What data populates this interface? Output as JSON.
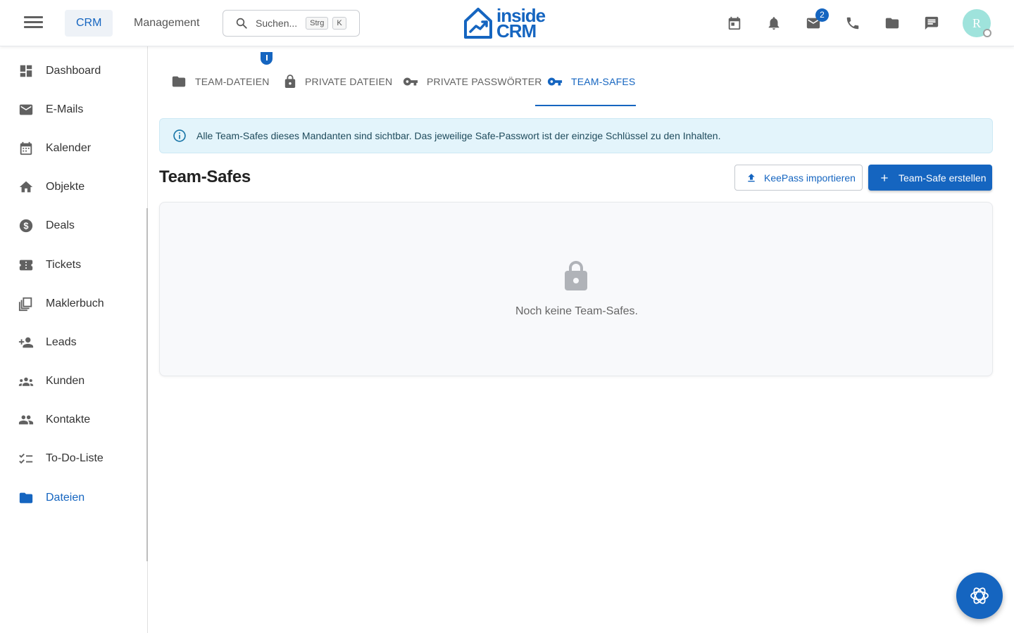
{
  "header": {
    "nav": [
      "CRM",
      "Management"
    ],
    "search": {
      "placeholder": "Suchen...",
      "shortcut": [
        "Strg",
        "K"
      ]
    },
    "logo": {
      "line1": "inside",
      "line2": "CRM"
    },
    "icons": [
      "calendar-icon",
      "bell-icon",
      "mail-icon",
      "phone-icon",
      "folder-icon",
      "chat-icon"
    ],
    "mail_badge": "2",
    "avatar_initial": "R"
  },
  "sidebar": {
    "items": [
      {
        "label": "Dashboard",
        "icon": "dashboard-icon"
      },
      {
        "label": "E-Mails",
        "icon": "mail-icon"
      },
      {
        "label": "Kalender",
        "icon": "calendar-icon"
      },
      {
        "label": "Objekte",
        "icon": "home-icon"
      },
      {
        "label": "Deals",
        "icon": "dollar-icon"
      },
      {
        "label": "Tickets",
        "icon": "ticket-icon"
      },
      {
        "label": "Maklerbuch",
        "icon": "book-icon"
      },
      {
        "label": "Leads",
        "icon": "person-add-icon"
      },
      {
        "label": "Kunden",
        "icon": "groups-icon"
      },
      {
        "label": "Kontakte",
        "icon": "people-icon"
      },
      {
        "label": "To-Do-Liste",
        "icon": "checklist-icon"
      },
      {
        "label": "Dateien",
        "icon": "folder-icon",
        "active": true
      }
    ]
  },
  "tabs": [
    {
      "label": "TEAM-DATEIEN",
      "icon": "folder-icon"
    },
    {
      "label": "PRIVATE DATEIEN",
      "icon": "lock-icon"
    },
    {
      "label": "PRIVATE PASSWÖRTER",
      "icon": "key-icon"
    },
    {
      "label": "TEAM-SAFES",
      "icon": "key-icon",
      "active": true
    }
  ],
  "info": "Alle Team-Safes dieses Mandanten sind sichtbar. Das jeweilige Safe-Passwort ist der einzige Schlüssel zu den Inhalten.",
  "page": {
    "title": "Team-Safes",
    "import_label": "KeePass importieren",
    "create_label": "Team-Safe erstellen",
    "empty_text": "Noch keine Team-Safes."
  },
  "colors": {
    "accent": "#1565c0",
    "info_bg": "#e3f4fb",
    "avatar": "#9fe3dc"
  }
}
